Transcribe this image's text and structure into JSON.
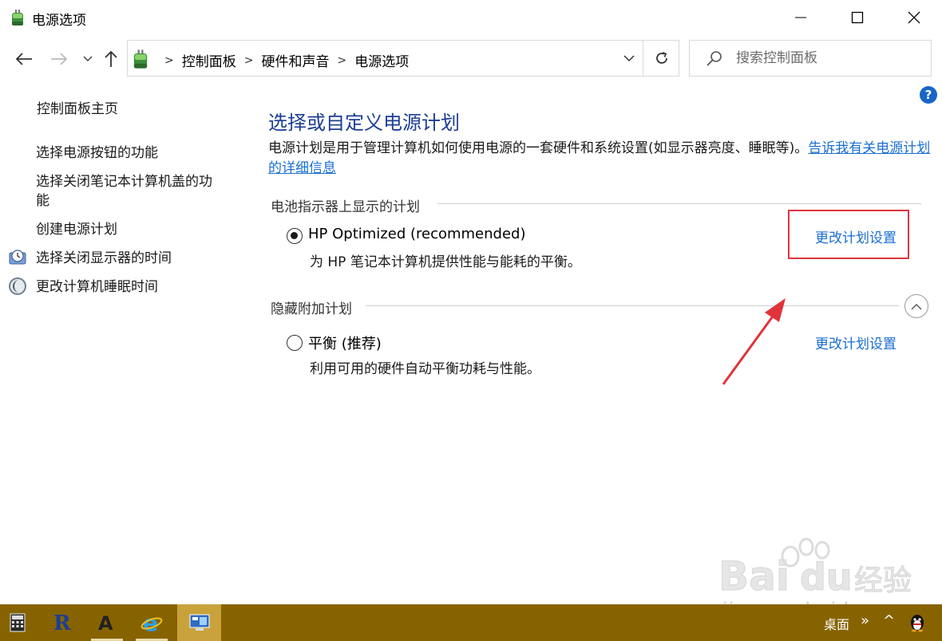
{
  "window": {
    "title": "电源选项"
  },
  "nav": {
    "breadcrumb": [
      "控制面板",
      "硬件和声音",
      "电源选项"
    ],
    "search_placeholder": "搜索控制面板"
  },
  "help_glyph": "?",
  "sidebar": {
    "home": "控制面板主页",
    "items": [
      {
        "label": "选择电源按钮的功能",
        "icon": null
      },
      {
        "label_line1": "选择关闭笔记本计算机盖的功",
        "label_line2": "能",
        "icon": null
      },
      {
        "label": "创建电源计划",
        "icon": null
      },
      {
        "label": "选择关闭显示器的时间",
        "icon": "monitor-clock-icon"
      },
      {
        "label": "更改计算机睡眠时间",
        "icon": "moon-icon"
      }
    ]
  },
  "main": {
    "title": "选择或自定义电源计划",
    "description": "电源计划是用于管理计算机如何使用电源的一套硬件和系统设置(如显示器亮度、睡眠等)。",
    "description_link": "告诉我有关电源计划的详细信息",
    "battery_group_label": "电池指示器上显示的计划",
    "hidden_group_label": "隐藏附加计划",
    "plans": [
      {
        "name": "HP Optimized (recommended)",
        "description": "为 HP 笔记本计算机提供性能与能耗的平衡。",
        "link": "更改计划设置",
        "selected": true
      },
      {
        "name": "平衡 (推荐)",
        "description": "利用可用的硬件自动平衡功耗与性能。",
        "link": "更改计划设置",
        "selected": false
      }
    ]
  },
  "watermark": {
    "text": "jingyan.baidu.com"
  },
  "taskbar": {
    "desktop_label": "桌面",
    "chevrons": "»",
    "tray_up": "^"
  },
  "colors": {
    "title_blue": "#1c3f94",
    "link_blue": "#1a6ed0",
    "highlight_red": "#e0343c",
    "taskbar": "#876300"
  }
}
